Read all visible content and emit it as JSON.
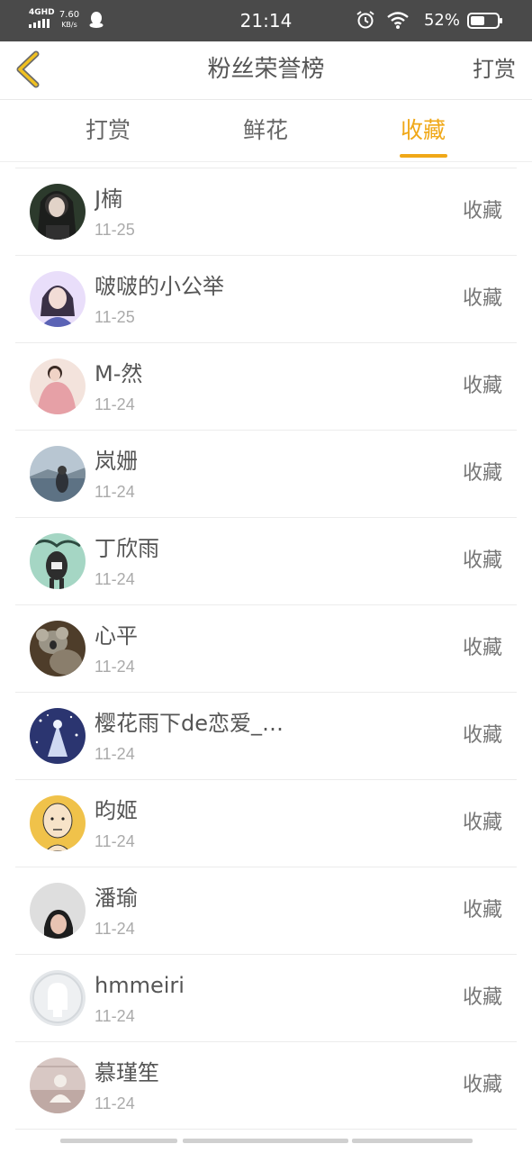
{
  "status_bar": {
    "network": "4GHD",
    "speed_value": "7.60",
    "speed_unit": "KB/s",
    "time": "21:14",
    "battery": "52%",
    "icons": [
      "signal-icon",
      "qq-penguin-icon",
      "alarm-icon",
      "wifi-icon",
      "battery-icon"
    ]
  },
  "nav": {
    "title": "粉丝荣誉榜",
    "action": "打赏",
    "back_icon": "chevron-left-icon",
    "back_color": "#f0c020"
  },
  "tabs": [
    {
      "label": "打赏",
      "active": false
    },
    {
      "label": "鲜花",
      "active": false
    },
    {
      "label": "收藏",
      "active": true
    }
  ],
  "colors": {
    "accent": "#f0a818",
    "status_bar_bg": "#4a4a4a",
    "text": "#555555",
    "muted": "#aaaaaa"
  },
  "fans": [
    {
      "name": "J楠",
      "date": "11-25",
      "action": "收藏",
      "avatar": "avatar-dark-hair"
    },
    {
      "name": "啵啵的小公举",
      "date": "11-25",
      "action": "收藏",
      "avatar": "avatar-girl-purple"
    },
    {
      "name": "M-然",
      "date": "11-24",
      "action": "收藏",
      "avatar": "avatar-pink-hoodie"
    },
    {
      "name": "岚姗",
      "date": "11-24",
      "action": "收藏",
      "avatar": "avatar-lake"
    },
    {
      "name": "丁欣雨",
      "date": "11-24",
      "action": "收藏",
      "avatar": "avatar-graffiti"
    },
    {
      "name": "心平",
      "date": "11-24",
      "action": "收藏",
      "avatar": "avatar-koala"
    },
    {
      "name": "樱花雨下de恋爱_…",
      "date": "11-24",
      "action": "收藏",
      "avatar": "avatar-starry"
    },
    {
      "name": "昀姬",
      "date": "11-24",
      "action": "收藏",
      "avatar": "avatar-cartoon-bald"
    },
    {
      "name": "潘瑜",
      "date": "11-24",
      "action": "收藏",
      "avatar": "avatar-selfie"
    },
    {
      "name": "hmmeiri",
      "date": "11-24",
      "action": "收藏",
      "avatar": "avatar-default"
    },
    {
      "name": "慕瑾笙",
      "date": "11-24",
      "action": "收藏",
      "avatar": "avatar-vintage"
    }
  ]
}
